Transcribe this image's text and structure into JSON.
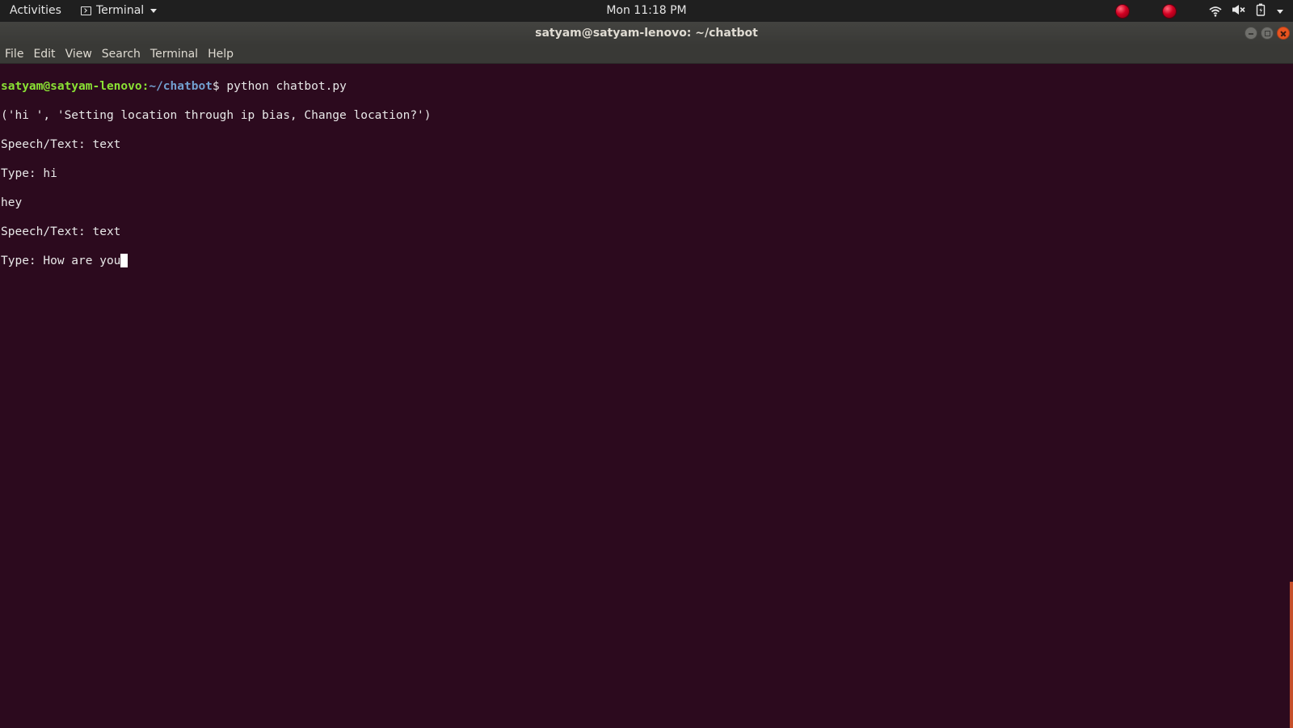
{
  "topbar": {
    "activities": "Activities",
    "app_menu_label": "Terminal",
    "clock": "Mon 11:18 PM",
    "tray_icons": [
      "red-indicator-icon",
      "red-indicator-icon",
      "wifi-icon",
      "volume-muted-icon",
      "battery-icon",
      "chevron-down-icon"
    ]
  },
  "window": {
    "title": "satyam@satyam-lenovo: ~/chatbot",
    "buttons": [
      "minimize",
      "maximize",
      "close"
    ]
  },
  "menubar": {
    "items": [
      "File",
      "Edit",
      "View",
      "Search",
      "Terminal",
      "Help"
    ]
  },
  "terminal": {
    "prompt_user": "satyam@satyam-lenovo",
    "prompt_sep": ":",
    "prompt_path": "~/chatbot",
    "prompt_symbol": "$ ",
    "command": "python chatbot.py",
    "output": [
      "('hi ', 'Setting location through ip bias, Change location?')",
      "Speech/Text: text",
      "Type: hi",
      "hey",
      "Speech/Text: text"
    ],
    "current_input": "Type: How are you"
  },
  "colors": {
    "terminal_bg": "#2c0a1e",
    "prompt_user": "#8ae234",
    "prompt_path": "#729fcf",
    "close_button": "#e9541f",
    "scrollbar": "#c64f2a"
  }
}
